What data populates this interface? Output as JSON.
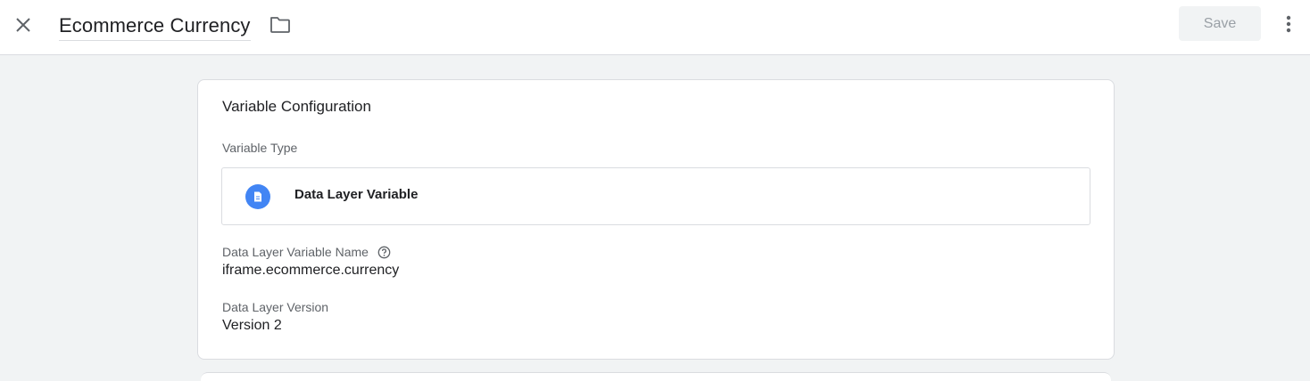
{
  "header": {
    "title": "Ecommerce Currency",
    "save_label": "Save",
    "close_icon": "close-icon",
    "folder_icon": "folder-icon",
    "more_icon": "more-vert-icon"
  },
  "config": {
    "heading": "Variable Configuration",
    "type_label": "Variable Type",
    "type_value": "Data Layer Variable",
    "type_icon": "document-icon",
    "name_label": "Data Layer Variable Name",
    "name_value": "iframe.ecommerce.currency",
    "version_label": "Data Layer Version",
    "version_value": "Version 2"
  },
  "colors": {
    "accent": "#4285f4",
    "background": "#f1f3f4"
  }
}
